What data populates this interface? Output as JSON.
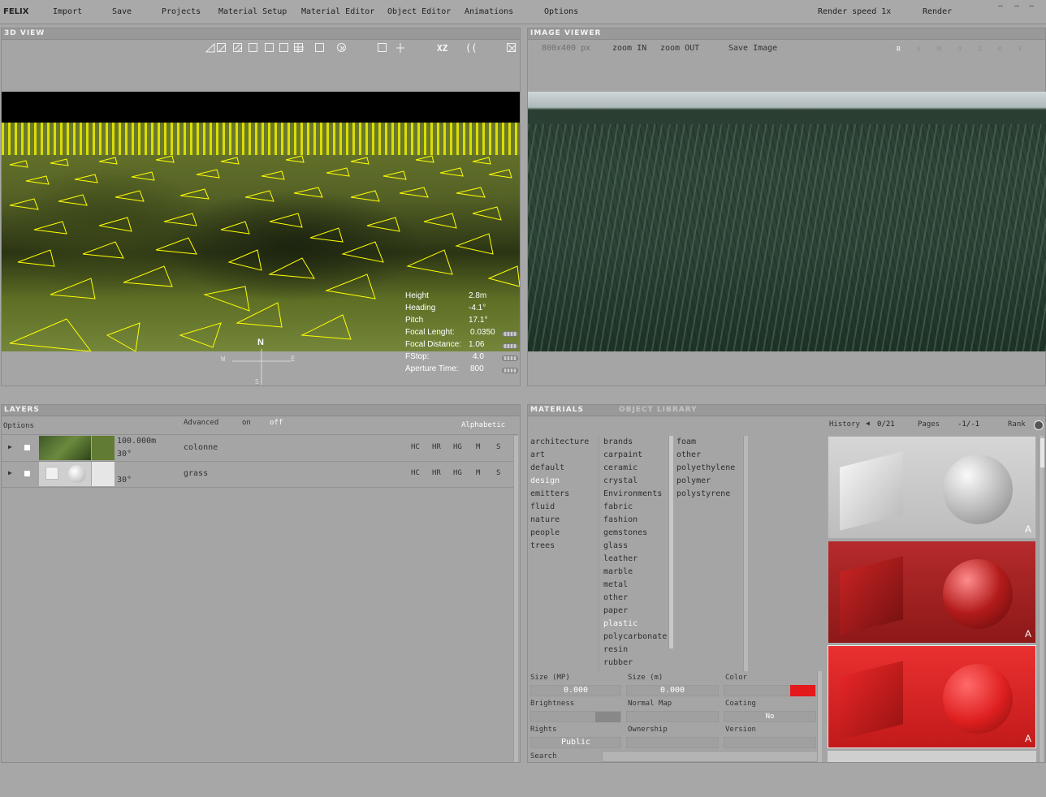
{
  "app": {
    "title": "FELIX"
  },
  "menu": {
    "items": [
      "Import",
      "Save",
      "Projects",
      "Material Setup",
      "Material Editor",
      "Object Editor",
      "Animations",
      "Options"
    ],
    "render_speed": "Render speed 1x",
    "render": "Render"
  },
  "view3d": {
    "title": "3D VIEW",
    "toolbar_right": "XZ",
    "readouts": [
      {
        "label": "Height",
        "value": "2.8m"
      },
      {
        "label": "Heading",
        "value": "-4.1°"
      },
      {
        "label": "Pitch",
        "value": "17.1°"
      },
      {
        "label": "Focal Lenght:",
        "value": "0.0350"
      },
      {
        "label": "Focal Distance:",
        "value": "1.06"
      },
      {
        "label": "FStop:",
        "value": "4.0"
      },
      {
        "label": "Aperture Time:",
        "value": "800"
      }
    ],
    "compass": {
      "n": "N",
      "w": "W",
      "e": "E",
      "s": "S"
    }
  },
  "viewer": {
    "title": "IMAGE VIEWER",
    "resolution": "800x400 px",
    "zoom_in": "zoom IN",
    "zoom_out": "zoom OUT",
    "save_image": "Save Image",
    "channels": [
      "R",
      "S",
      "M",
      "O",
      "Z",
      "R",
      "F"
    ]
  },
  "layers": {
    "title": "LAYERS",
    "options": "Options",
    "advanced": "Advanced",
    "on": "on",
    "off": "off",
    "alphabetic": "Alphabetic",
    "flags": [
      "HC",
      "HR",
      "HG",
      "M",
      "S"
    ],
    "rows": [
      {
        "size": "100.000m",
        "angle": "30°",
        "name": "colonne"
      },
      {
        "size": "",
        "angle": "30°",
        "name": "grass"
      }
    ]
  },
  "materials": {
    "tabs": [
      "MATERIALS",
      "OBJECT LIBRARY"
    ],
    "history_label": "History",
    "history_value": "0/21",
    "pages_label": "Pages",
    "pages_value": "-1/-1",
    "rank_label": "Rank",
    "col1": [
      "architecture",
      "art",
      "default",
      "design",
      "emitters",
      "fluid",
      "nature",
      "people",
      "trees"
    ],
    "col2": [
      "brands",
      "carpaint",
      "ceramic",
      "crystal",
      "Environments",
      "fabric",
      "fashion",
      "gemstones",
      "glass",
      "leather",
      "marble",
      "metal",
      "other",
      "paper",
      "plastic",
      "polycarbonate",
      "resin",
      "rubber"
    ],
    "col3": [
      "foam",
      "other",
      "polyethylene",
      "polymer",
      "polystyrene"
    ],
    "props": {
      "size_mp_label": "Size (MP)",
      "size_mp_value": "0.000",
      "size_m_label": "Size (m)",
      "size_m_value": "0.000",
      "color_label": "Color",
      "color_value": "#e3191b",
      "brightness_label": "Brightness",
      "normal_map_label": "Normal Map",
      "coating_label": "Coating",
      "coating_value": "No",
      "rights_label": "Rights",
      "rights_value": "Public",
      "ownership_label": "Ownership",
      "version_label": "Version",
      "search_label": "Search"
    },
    "swatches": [
      {
        "tag": "A",
        "color": "#d9d9d9"
      },
      {
        "tag": "A",
        "color": "#b21d1d"
      },
      {
        "tag": "A",
        "color": "#e02222"
      }
    ]
  },
  "colors": {
    "accent_yellow": "#ffff00",
    "material_red": "#e3191b"
  }
}
